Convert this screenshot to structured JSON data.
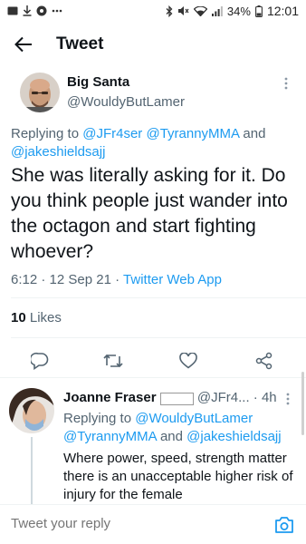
{
  "status_bar": {
    "battery": "34%",
    "time": "12:01",
    "icons": [
      "notification-icon",
      "download-icon",
      "circle-app-icon",
      "more-dots-icon",
      "bluetooth-icon",
      "mute-icon",
      "wifi-icon",
      "signal-icon",
      "battery-icon"
    ]
  },
  "header": {
    "title": "Tweet"
  },
  "tweet": {
    "author_name": "Big Santa",
    "author_handle": "@WouldyButLamer",
    "replying_prefix": "Replying to",
    "replying_users": [
      "@JFr4ser",
      "@TyrannyMMA",
      "@jakeshieldsajj"
    ],
    "replying_and": "and",
    "text": "She was literally asking for it. Do you think people just wander into the octagon and start fighting whoever?",
    "time": "6:12",
    "date": "12 Sep 21",
    "source": "Twitter Web App",
    "likes_count": "10",
    "likes_label": "Likes"
  },
  "reply": {
    "author_name": "Joanne Fraser",
    "name_extra": "   ",
    "handle": "@JFr4...",
    "time": "4h",
    "replying_prefix": "Replying to",
    "replying_users": [
      "@WouldyButLamer",
      "@TyrannyMMA",
      "@jakeshieldsajj"
    ],
    "replying_and": "and",
    "text": "Where power, speed, strength matter there is an unacceptable higher risk of injury for the female"
  },
  "composer": {
    "placeholder": "Tweet your reply"
  },
  "colors": {
    "accent": "#1d9bf0",
    "secondary_text": "#536471",
    "primary_text": "#0f1419",
    "divider": "#eff3f4"
  }
}
